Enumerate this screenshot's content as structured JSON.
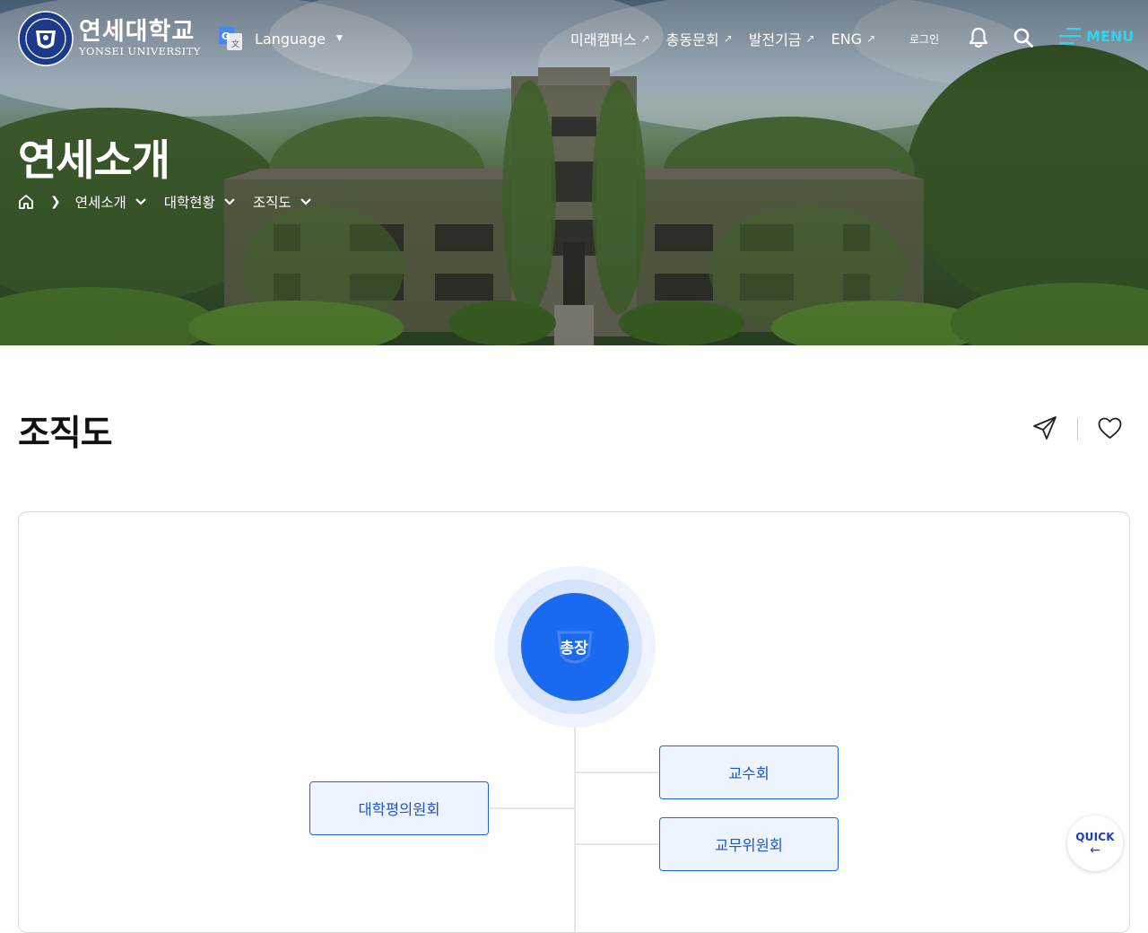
{
  "header": {
    "logo": {
      "name_ko": "연세대학교",
      "name_en": "YONSEI UNIVERSITY"
    },
    "language": {
      "label": "Language"
    },
    "nav": [
      {
        "label": "미래캠퍼스"
      },
      {
        "label": "총동문회"
      },
      {
        "label": "발전기금"
      },
      {
        "label": "ENG"
      }
    ],
    "nav_ext_symbol": "↗",
    "login_label": "로그인",
    "menu_label": "MENU",
    "menu_color": "#2ad7f0"
  },
  "hero": {
    "title": "연세소개",
    "breadcrumb": [
      {
        "label": "연세소개"
      },
      {
        "label": "대학현황"
      },
      {
        "label": "조직도"
      }
    ]
  },
  "page": {
    "title": "조직도"
  },
  "org_chart": {
    "root": {
      "label": "총장",
      "color": "#1a6af0"
    },
    "nodes": [
      {
        "label": "교수회"
      },
      {
        "label": "대학평의원회"
      },
      {
        "label": "교무위원회"
      }
    ],
    "node_border_color": "#1d63e6",
    "node_fill_color": "#eef4fd"
  },
  "quick": {
    "label": "QUICK",
    "arrow": "←"
  }
}
